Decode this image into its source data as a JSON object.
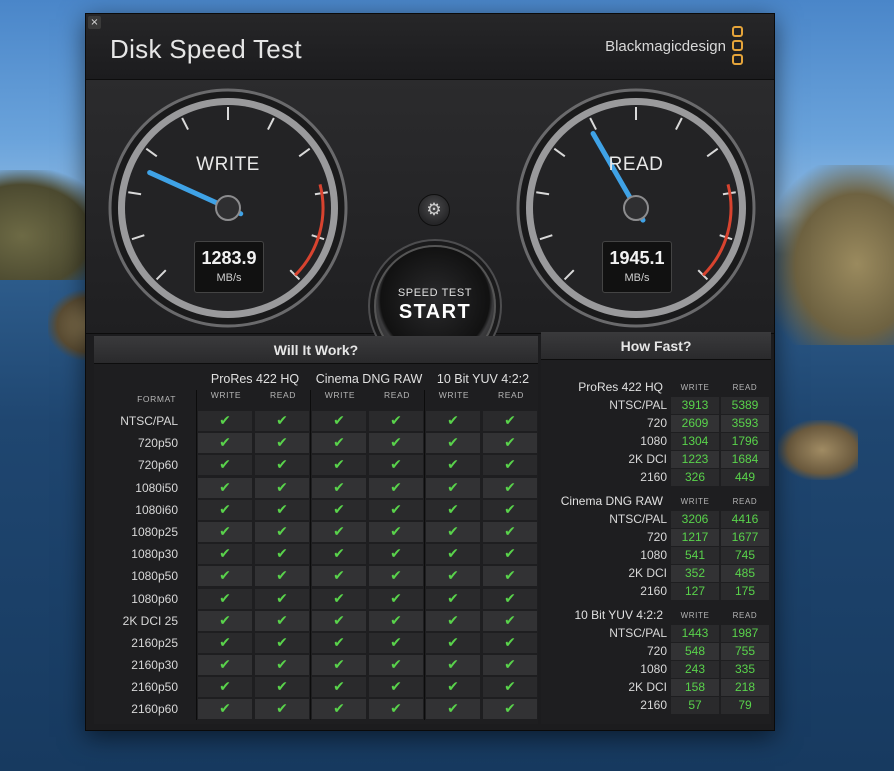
{
  "window": {
    "title": "Disk Speed Test",
    "brand": "Blackmagicdesign",
    "close_glyph": "×"
  },
  "gauges": {
    "write": {
      "label": "WRITE",
      "value": "1283.9",
      "unit": "MB/s",
      "level": 1283.9
    },
    "read": {
      "label": "READ",
      "value": "1945.1",
      "unit": "MB/s",
      "level": 1945.1
    }
  },
  "controls": {
    "settings_icon": "gear-icon",
    "start_sub": "SPEED TEST",
    "start_main": "START"
  },
  "colors": {
    "check": "#59d34b",
    "value_green": "#59d34b",
    "brand_orange": "#e5a43a",
    "needle_blue": "#3fa2e6",
    "redline": "#d8432f"
  },
  "will_it_work": {
    "title": "Will It Work?",
    "format_header": "FORMAT",
    "groups": [
      "ProRes 422 HQ",
      "Cinema DNG RAW",
      "10 Bit YUV 4:2:2"
    ],
    "subheads": [
      "WRITE",
      "READ"
    ],
    "check_glyph": "✔",
    "rows": [
      "NTSC/PAL",
      "720p50",
      "720p60",
      "1080i50",
      "1080i60",
      "1080p25",
      "1080p30",
      "1080p50",
      "1080p60",
      "2K DCI 25",
      "2160p25",
      "2160p30",
      "2160p50",
      "2160p60"
    ]
  },
  "how_fast": {
    "title": "How Fast?",
    "col_heads": [
      "WRITE",
      "READ"
    ],
    "blocks": [
      {
        "name": "ProRes 422 HQ",
        "rows": [
          {
            "format": "NTSC/PAL",
            "write": "3913",
            "read": "5389"
          },
          {
            "format": "720",
            "write": "2609",
            "read": "3593"
          },
          {
            "format": "1080",
            "write": "1304",
            "read": "1796"
          },
          {
            "format": "2K DCI",
            "write": "1223",
            "read": "1684"
          },
          {
            "format": "2160",
            "write": "326",
            "read": "449"
          }
        ]
      },
      {
        "name": "Cinema DNG RAW",
        "rows": [
          {
            "format": "NTSC/PAL",
            "write": "3206",
            "read": "4416"
          },
          {
            "format": "720",
            "write": "1217",
            "read": "1677"
          },
          {
            "format": "1080",
            "write": "541",
            "read": "745"
          },
          {
            "format": "2K DCI",
            "write": "352",
            "read": "485"
          },
          {
            "format": "2160",
            "write": "127",
            "read": "175"
          }
        ]
      },
      {
        "name": "10 Bit YUV 4:2:2",
        "rows": [
          {
            "format": "NTSC/PAL",
            "write": "1443",
            "read": "1987"
          },
          {
            "format": "720",
            "write": "548",
            "read": "755"
          },
          {
            "format": "1080",
            "write": "243",
            "read": "335"
          },
          {
            "format": "2K DCI",
            "write": "158",
            "read": "218"
          },
          {
            "format": "2160",
            "write": "57",
            "read": "79"
          }
        ]
      }
    ]
  }
}
